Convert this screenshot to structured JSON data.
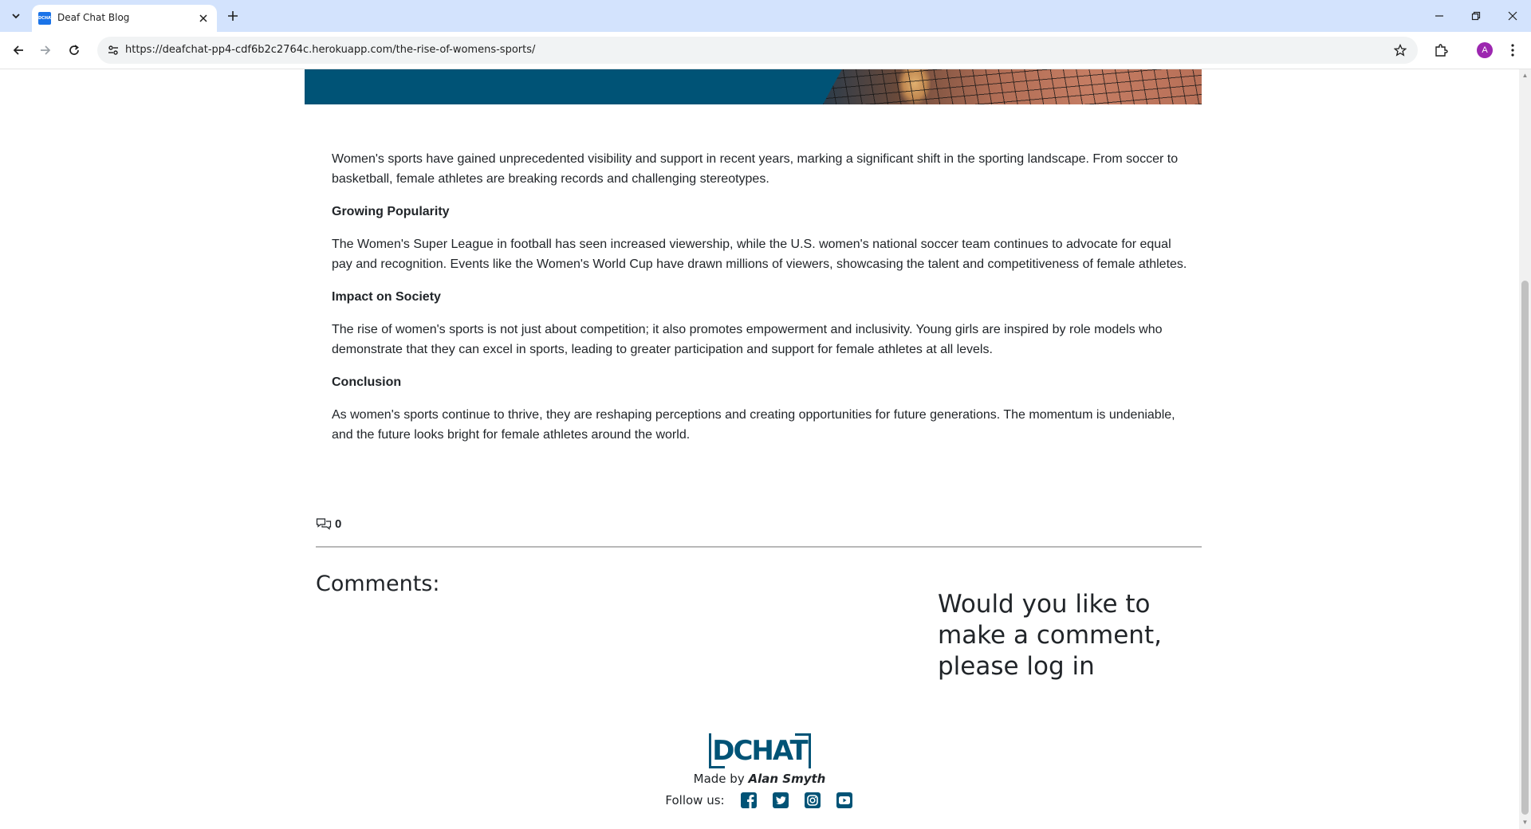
{
  "browser": {
    "tab_title": "Deaf Chat Blog",
    "favicon_text": "DCHAT",
    "url": "https://deafchat-pp4-cdf6b2c2764c.herokuapp.com/the-rise-of-womens-sports/",
    "profile_initial": "A"
  },
  "article": {
    "intro": "Women's sports have gained unprecedented visibility and support in recent years, marking a significant shift in the sporting landscape. From soccer to basketball, female athletes are breaking records and challenging stereotypes.",
    "sections": [
      {
        "heading": "Growing Popularity",
        "body": "The Women's Super League in football has seen increased viewership, while the U.S. women's national soccer team continues to advocate for equal pay and recognition. Events like the Women's World Cup have drawn millions of viewers, showcasing the talent and competitiveness of female athletes."
      },
      {
        "heading": "Impact on Society",
        "body": "The rise of women's sports is not just about competition; it also promotes empowerment and inclusivity. Young girls are inspired by role models who demonstrate that they can excel in sports, leading to greater participation and support for female athletes at all levels."
      },
      {
        "heading": "Conclusion",
        "body": "As women's sports continue to thrive, they are reshaping perceptions and creating opportunities for future generations. The momentum is undeniable, and the future looks bright for female athletes around the world."
      }
    ]
  },
  "comments": {
    "count": "0",
    "heading": "Comments:",
    "login_prompt": "Would you like to make a comment, please log in"
  },
  "footer": {
    "logo_text": "DCHAT",
    "made_by_prefix": "Made by",
    "author": "Alan Smyth",
    "follow_label": "Follow us:",
    "social_icons": [
      "facebook-icon",
      "twitter-icon",
      "instagram-icon",
      "youtube-icon"
    ]
  },
  "colors": {
    "brand": "#005376",
    "tab_strip": "#d3e3fd",
    "profile": "#9c27b0"
  }
}
